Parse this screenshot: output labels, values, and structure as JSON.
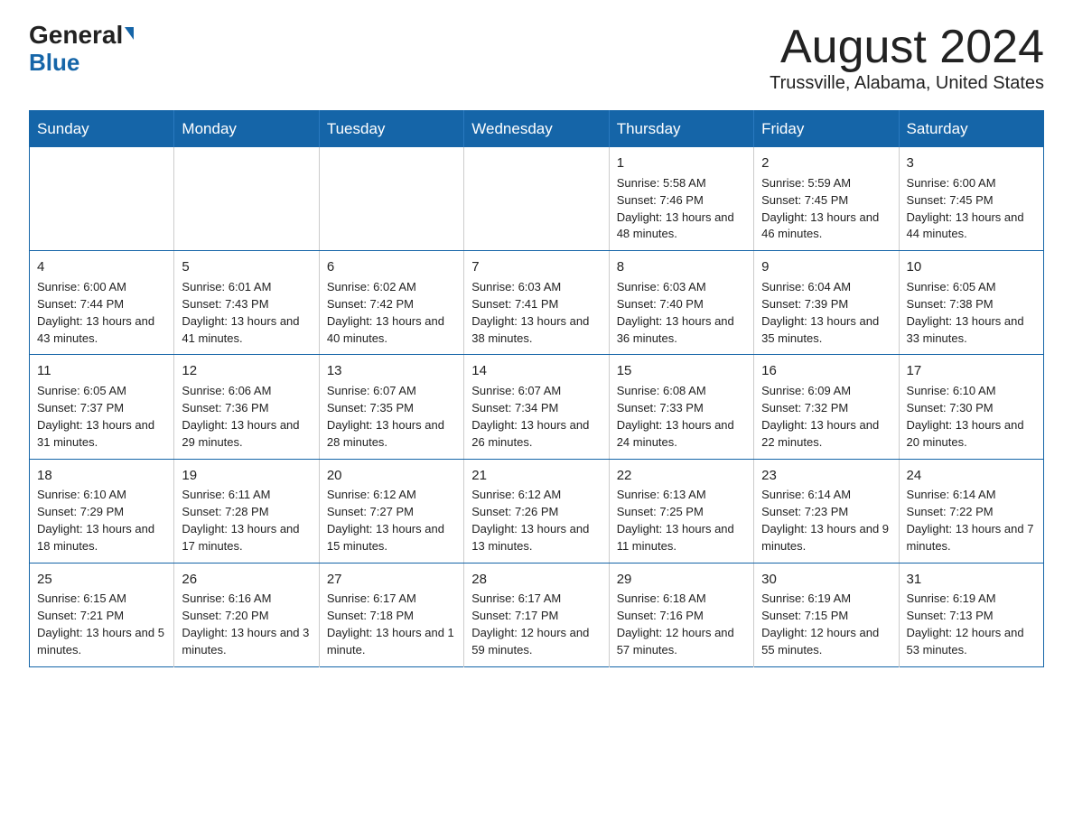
{
  "header": {
    "logo_line1": "General",
    "logo_line2": "Blue",
    "month": "August 2024",
    "location": "Trussville, Alabama, United States"
  },
  "weekdays": [
    "Sunday",
    "Monday",
    "Tuesday",
    "Wednesday",
    "Thursday",
    "Friday",
    "Saturday"
  ],
  "weeks": [
    [
      {
        "day": "",
        "info": ""
      },
      {
        "day": "",
        "info": ""
      },
      {
        "day": "",
        "info": ""
      },
      {
        "day": "",
        "info": ""
      },
      {
        "day": "1",
        "info": "Sunrise: 5:58 AM\nSunset: 7:46 PM\nDaylight: 13 hours and 48 minutes."
      },
      {
        "day": "2",
        "info": "Sunrise: 5:59 AM\nSunset: 7:45 PM\nDaylight: 13 hours and 46 minutes."
      },
      {
        "day": "3",
        "info": "Sunrise: 6:00 AM\nSunset: 7:45 PM\nDaylight: 13 hours and 44 minutes."
      }
    ],
    [
      {
        "day": "4",
        "info": "Sunrise: 6:00 AM\nSunset: 7:44 PM\nDaylight: 13 hours and 43 minutes."
      },
      {
        "day": "5",
        "info": "Sunrise: 6:01 AM\nSunset: 7:43 PM\nDaylight: 13 hours and 41 minutes."
      },
      {
        "day": "6",
        "info": "Sunrise: 6:02 AM\nSunset: 7:42 PM\nDaylight: 13 hours and 40 minutes."
      },
      {
        "day": "7",
        "info": "Sunrise: 6:03 AM\nSunset: 7:41 PM\nDaylight: 13 hours and 38 minutes."
      },
      {
        "day": "8",
        "info": "Sunrise: 6:03 AM\nSunset: 7:40 PM\nDaylight: 13 hours and 36 minutes."
      },
      {
        "day": "9",
        "info": "Sunrise: 6:04 AM\nSunset: 7:39 PM\nDaylight: 13 hours and 35 minutes."
      },
      {
        "day": "10",
        "info": "Sunrise: 6:05 AM\nSunset: 7:38 PM\nDaylight: 13 hours and 33 minutes."
      }
    ],
    [
      {
        "day": "11",
        "info": "Sunrise: 6:05 AM\nSunset: 7:37 PM\nDaylight: 13 hours and 31 minutes."
      },
      {
        "day": "12",
        "info": "Sunrise: 6:06 AM\nSunset: 7:36 PM\nDaylight: 13 hours and 29 minutes."
      },
      {
        "day": "13",
        "info": "Sunrise: 6:07 AM\nSunset: 7:35 PM\nDaylight: 13 hours and 28 minutes."
      },
      {
        "day": "14",
        "info": "Sunrise: 6:07 AM\nSunset: 7:34 PM\nDaylight: 13 hours and 26 minutes."
      },
      {
        "day": "15",
        "info": "Sunrise: 6:08 AM\nSunset: 7:33 PM\nDaylight: 13 hours and 24 minutes."
      },
      {
        "day": "16",
        "info": "Sunrise: 6:09 AM\nSunset: 7:32 PM\nDaylight: 13 hours and 22 minutes."
      },
      {
        "day": "17",
        "info": "Sunrise: 6:10 AM\nSunset: 7:30 PM\nDaylight: 13 hours and 20 minutes."
      }
    ],
    [
      {
        "day": "18",
        "info": "Sunrise: 6:10 AM\nSunset: 7:29 PM\nDaylight: 13 hours and 18 minutes."
      },
      {
        "day": "19",
        "info": "Sunrise: 6:11 AM\nSunset: 7:28 PM\nDaylight: 13 hours and 17 minutes."
      },
      {
        "day": "20",
        "info": "Sunrise: 6:12 AM\nSunset: 7:27 PM\nDaylight: 13 hours and 15 minutes."
      },
      {
        "day": "21",
        "info": "Sunrise: 6:12 AM\nSunset: 7:26 PM\nDaylight: 13 hours and 13 minutes."
      },
      {
        "day": "22",
        "info": "Sunrise: 6:13 AM\nSunset: 7:25 PM\nDaylight: 13 hours and 11 minutes."
      },
      {
        "day": "23",
        "info": "Sunrise: 6:14 AM\nSunset: 7:23 PM\nDaylight: 13 hours and 9 minutes."
      },
      {
        "day": "24",
        "info": "Sunrise: 6:14 AM\nSunset: 7:22 PM\nDaylight: 13 hours and 7 minutes."
      }
    ],
    [
      {
        "day": "25",
        "info": "Sunrise: 6:15 AM\nSunset: 7:21 PM\nDaylight: 13 hours and 5 minutes."
      },
      {
        "day": "26",
        "info": "Sunrise: 6:16 AM\nSunset: 7:20 PM\nDaylight: 13 hours and 3 minutes."
      },
      {
        "day": "27",
        "info": "Sunrise: 6:17 AM\nSunset: 7:18 PM\nDaylight: 13 hours and 1 minute."
      },
      {
        "day": "28",
        "info": "Sunrise: 6:17 AM\nSunset: 7:17 PM\nDaylight: 12 hours and 59 minutes."
      },
      {
        "day": "29",
        "info": "Sunrise: 6:18 AM\nSunset: 7:16 PM\nDaylight: 12 hours and 57 minutes."
      },
      {
        "day": "30",
        "info": "Sunrise: 6:19 AM\nSunset: 7:15 PM\nDaylight: 12 hours and 55 minutes."
      },
      {
        "day": "31",
        "info": "Sunrise: 6:19 AM\nSunset: 7:13 PM\nDaylight: 12 hours and 53 minutes."
      }
    ]
  ]
}
